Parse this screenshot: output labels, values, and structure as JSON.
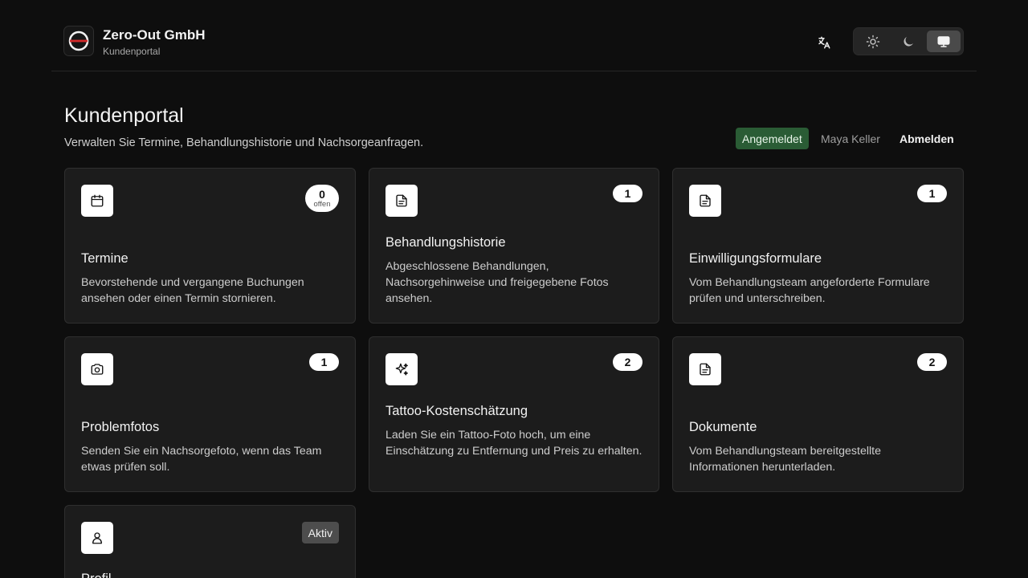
{
  "brand": {
    "name": "Zero-Out GmbH",
    "subtitle": "Kundenportal"
  },
  "header": {
    "language_icon": "translate-icon",
    "theme_options": [
      {
        "name": "light",
        "icon": "sun-icon"
      },
      {
        "name": "dark",
        "icon": "moon-icon"
      },
      {
        "name": "system",
        "icon": "monitor-icon",
        "active": true
      }
    ]
  },
  "page": {
    "title": "Kundenportal",
    "subtitle": "Verwalten Sie Termine, Behandlungshistorie und Nachsorgeanfragen."
  },
  "session": {
    "status": "Angemeldet",
    "user": "Maya Keller",
    "logout_label": "Abmelden"
  },
  "cards": [
    {
      "title": "Termine",
      "description": "Bevorstehende und vergangene Buchungen ansehen oder einen Termin stornieren.",
      "count": "0",
      "count_label": "offen",
      "icon": "calendar-icon"
    },
    {
      "title": "Behandlungshistorie",
      "description": "Abgeschlossene Behandlungen, Nachsorgehinweise und freigegebene Fotos ansehen.",
      "count": "1",
      "icon": "document-icon"
    },
    {
      "title": "Einwilligungsformulare",
      "description": "Vom Behandlungsteam angeforderte Formulare prüfen und unterschreiben.",
      "count": "1",
      "icon": "document-icon"
    },
    {
      "title": "Problemfotos",
      "description": "Senden Sie ein Nachsorgefoto, wenn das Team etwas prüfen soll.",
      "count": "1",
      "icon": "camera-icon"
    },
    {
      "title": "Tattoo-Kostenschätzung",
      "description": "Laden Sie ein Tattoo-Foto hoch, um eine Einschätzung zu Entfernung und Preis zu erhalten.",
      "count": "2",
      "icon": "sparkles-icon"
    },
    {
      "title": "Dokumente",
      "description": "Vom Behandlungsteam bereitgestellte Informationen herunterladen.",
      "count": "2",
      "icon": "document-icon"
    },
    {
      "title": "Profil",
      "description": "",
      "count": "Aktiv",
      "icon": "user-icon"
    }
  ]
}
